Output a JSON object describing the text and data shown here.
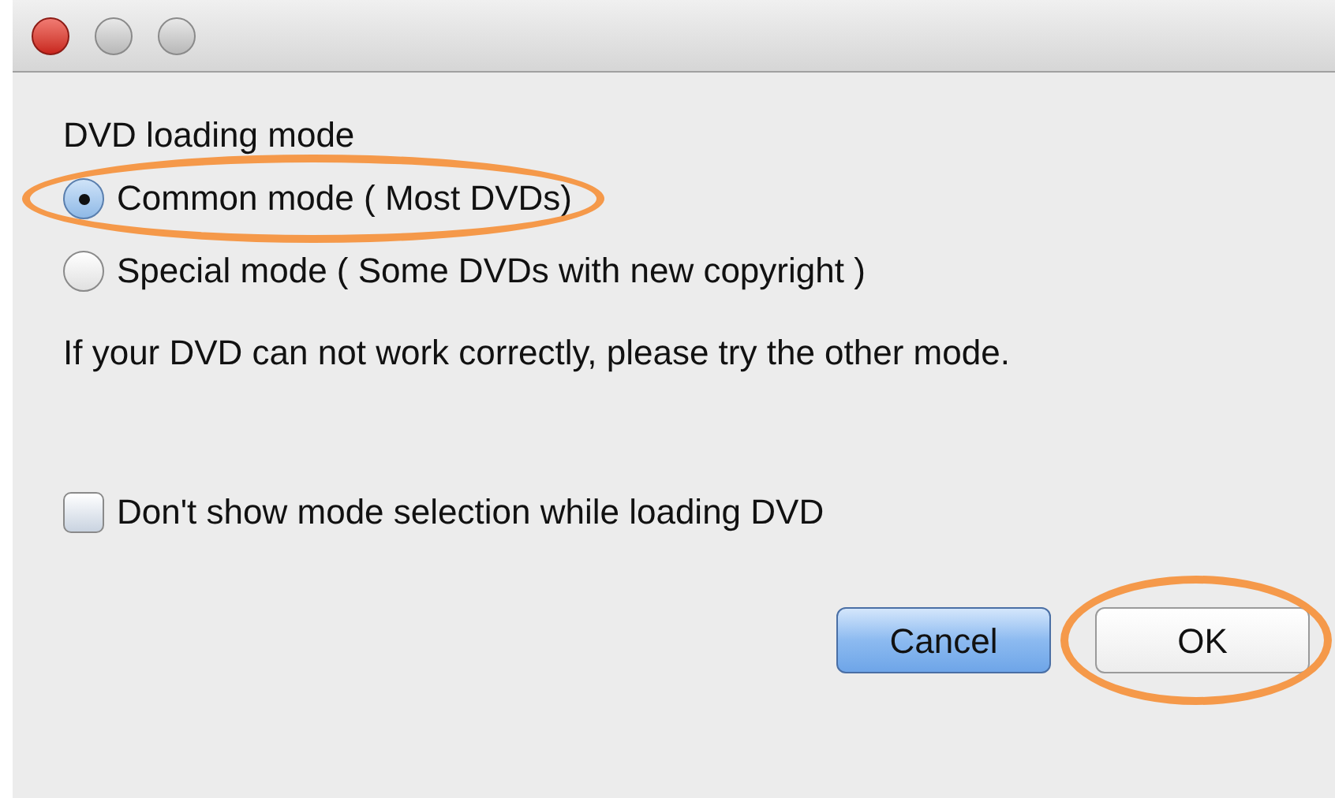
{
  "dialog": {
    "heading": "DVD loading mode",
    "modes": [
      {
        "label": "Common mode ( Most DVDs)",
        "selected": true,
        "highlighted": true
      },
      {
        "label": "Special mode ( Some DVDs with new copyright )",
        "selected": false,
        "highlighted": false
      }
    ],
    "hint": "If your DVD can not work correctly, please try the other mode.",
    "checkbox": {
      "label": "Don't show mode selection while loading DVD",
      "checked": false
    },
    "buttons": [
      {
        "label": "Cancel",
        "default": true,
        "highlighted": false
      },
      {
        "label": "OK",
        "default": false,
        "highlighted": true
      }
    ]
  }
}
